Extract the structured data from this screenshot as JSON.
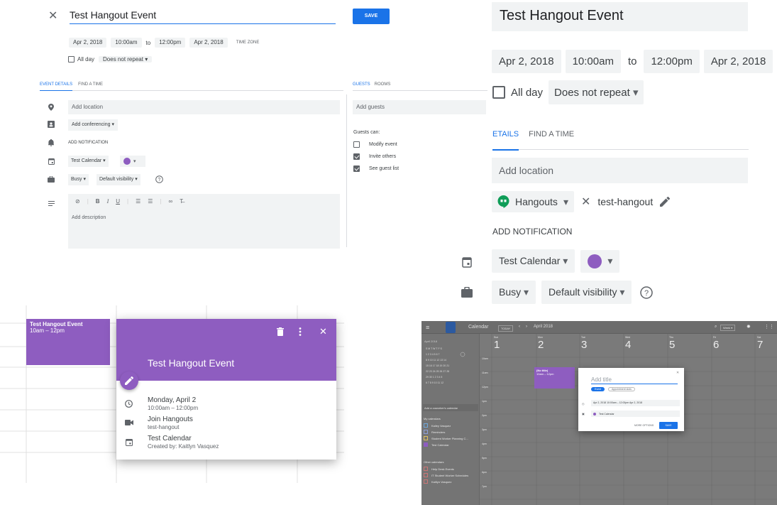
{
  "panel1": {
    "title_value": "Test Hangout Event",
    "save_label": "SAVE",
    "start_date": "Apr 2, 2018",
    "start_time": "10:00am",
    "to": "to",
    "end_time": "12:00pm",
    "end_date": "Apr 2, 2018",
    "timezone_label": "TIME ZONE",
    "all_day": "All day",
    "repeat": "Does not repeat",
    "tabs": [
      "EVENT DETAILS",
      "FIND A TIME"
    ],
    "guest_tabs": [
      "GUESTS",
      "ROOMS"
    ],
    "location_placeholder": "Add location",
    "conferencing": "Add conferencing",
    "notification": "ADD NOTIFICATION",
    "calendar": "Test Calendar",
    "busy": "Busy",
    "visibility": "Default visibility",
    "description_placeholder": "Add description",
    "guests_placeholder": "Add guests",
    "guests_can": "Guests can:",
    "guest_perms": [
      {
        "label": "Modify event",
        "checked": false
      },
      {
        "label": "Invite others",
        "checked": true
      },
      {
        "label": "See guest list",
        "checked": true
      }
    ]
  },
  "panel2": {
    "title": "Test Hangout Event",
    "start_date": "Apr 2, 2018",
    "start_time": "10:00am",
    "to": "to",
    "end_time": "12:00pm",
    "end_date": "Apr 2, 2018",
    "all_day": "All day",
    "repeat": "Does not repeat",
    "tab_active": "ETAILS",
    "tab_other": "FIND A TIME",
    "location_placeholder": "Add location",
    "hangouts": "Hangouts",
    "hangout_name": "test-hangout",
    "notification": "ADD NOTIFICATION",
    "calendar": "Test Calendar",
    "busy": "Busy",
    "visibility": "Default visibility"
  },
  "panel3": {
    "event_title": "Test Hangout Event",
    "event_time": "10am – 12pm",
    "card_title": "Test Hangout Event",
    "date": "Monday, April 2",
    "time": "10:00am – 12:00pm",
    "join": "Join Hangouts",
    "hangout": "test-hangout",
    "calendar": "Test Calendar",
    "created_by": "Created by: Kaitlyn Vasquez"
  },
  "panel4": {
    "app_name": "Calendar",
    "today": "TODAY",
    "month": "April 2018",
    "view": "Week",
    "days": [
      {
        "name": "Sun",
        "num": "1"
      },
      {
        "name": "Mon",
        "num": "2"
      },
      {
        "name": "Tue",
        "num": "3"
      },
      {
        "name": "Wed",
        "num": "4"
      },
      {
        "name": "Thu",
        "num": "5"
      },
      {
        "name": "Fri",
        "num": "6"
      },
      {
        "name": "Sat",
        "num": "7"
      }
    ],
    "times": [
      "10am",
      "11am",
      "12pm",
      "1pm",
      "2pm",
      "3pm",
      "4pm",
      "5pm",
      "6pm",
      "7pm",
      "8pm",
      "9pm"
    ],
    "mini_month": "April 2018",
    "add_coworker": "Add a coworker's calendar",
    "my_calendars_label": "My calendars",
    "my_calendars": [
      "Kailey Vasquez",
      "Reminders",
      "Student Worker Planning C...",
      "Test Calendar"
    ],
    "other_calendars_label": "Other calendars",
    "other_calendars": [
      "Help Desk Events",
      "IT Student Worker Schedules",
      "Kaitlyn Vasquez"
    ],
    "event_title": "(No title)",
    "event_time": "10am – 12pm",
    "dialog_placeholder": "Add title",
    "dialog_tab_event": "Event",
    "dialog_tab_slots": "Appointment slots",
    "dialog_datetime": "Apr 2, 2018   10:00am  –  12:00pm   Apr 2, 2018",
    "dialog_calendar": "Test Calendar",
    "more_options": "MORE OPTIONS",
    "save": "SAVE"
  }
}
